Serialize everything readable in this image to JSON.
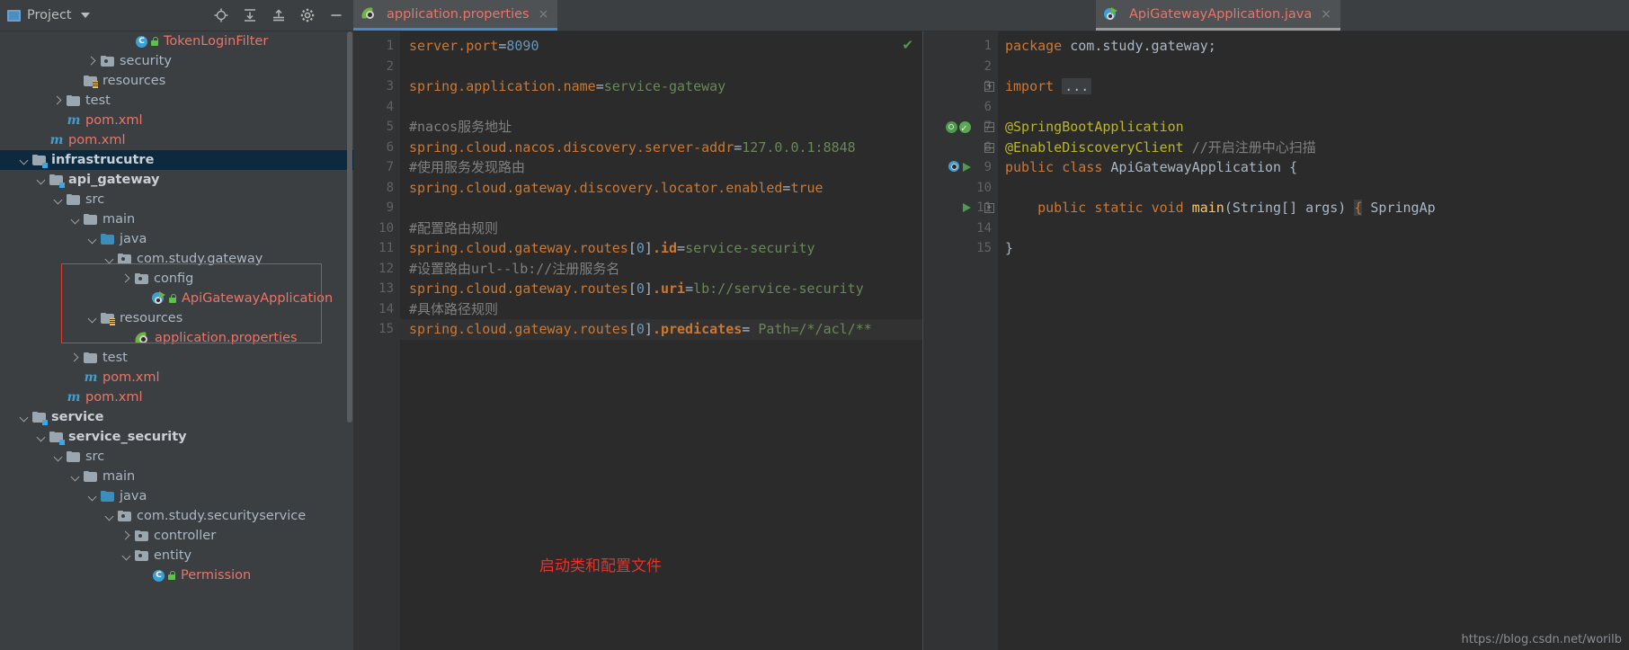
{
  "project_panel": {
    "title": "Project",
    "icons": [
      "locate-icon",
      "expand-all-icon",
      "collapse-all-icon",
      "settings-gear-icon",
      "minimize-icon"
    ],
    "tree": [
      {
        "label": "TokenLoginFilter",
        "type": "class",
        "indent": 7,
        "arrow": "none",
        "color": "red"
      },
      {
        "label": "security",
        "type": "package",
        "indent": 5,
        "arrow": "right",
        "color": "normal"
      },
      {
        "label": "resources",
        "type": "resources-folder",
        "indent": 4,
        "arrow": "none",
        "color": "normal"
      },
      {
        "label": "test",
        "type": "folder",
        "indent": 3,
        "arrow": "right",
        "color": "normal"
      },
      {
        "label": "pom.xml",
        "type": "maven",
        "indent": 3,
        "arrow": "none",
        "color": "red"
      },
      {
        "label": "pom.xml",
        "type": "maven",
        "indent": 2,
        "arrow": "none",
        "color": "red"
      },
      {
        "label": "infrastrucutre",
        "type": "module",
        "indent": 1,
        "arrow": "down",
        "color": "module",
        "selected": true
      },
      {
        "label": "api_gateway",
        "type": "module",
        "indent": 2,
        "arrow": "down",
        "color": "module"
      },
      {
        "label": "src",
        "type": "folder",
        "indent": 3,
        "arrow": "down",
        "color": "normal"
      },
      {
        "label": "main",
        "type": "folder",
        "indent": 4,
        "arrow": "down",
        "color": "normal"
      },
      {
        "label": "java",
        "type": "source-folder",
        "indent": 5,
        "arrow": "down",
        "color": "normal"
      },
      {
        "label": "com.study.gateway",
        "type": "package",
        "indent": 6,
        "arrow": "down",
        "color": "normal"
      },
      {
        "label": "config",
        "type": "package",
        "indent": 7,
        "arrow": "right",
        "color": "normal"
      },
      {
        "label": "ApiGatewayApplication",
        "type": "springboot-class",
        "indent": 8,
        "arrow": "none",
        "color": "red"
      },
      {
        "label": "resources",
        "type": "resources-folder",
        "indent": 5,
        "arrow": "down",
        "color": "normal"
      },
      {
        "label": "application.properties",
        "type": "spring-properties",
        "indent": 7,
        "arrow": "none",
        "color": "red"
      },
      {
        "label": "test",
        "type": "folder",
        "indent": 4,
        "arrow": "right",
        "color": "normal"
      },
      {
        "label": "pom.xml",
        "type": "maven",
        "indent": 4,
        "arrow": "none",
        "color": "red"
      },
      {
        "label": "pom.xml",
        "type": "maven",
        "indent": 3,
        "arrow": "none",
        "color": "red"
      },
      {
        "label": "service",
        "type": "module",
        "indent": 1,
        "arrow": "down",
        "color": "module"
      },
      {
        "label": "service_security",
        "type": "module",
        "indent": 2,
        "arrow": "down",
        "color": "module"
      },
      {
        "label": "src",
        "type": "folder",
        "indent": 3,
        "arrow": "down",
        "color": "normal"
      },
      {
        "label": "main",
        "type": "folder",
        "indent": 4,
        "arrow": "down",
        "color": "normal"
      },
      {
        "label": "java",
        "type": "source-folder",
        "indent": 5,
        "arrow": "down",
        "color": "normal"
      },
      {
        "label": "com.study.securityservice",
        "type": "package",
        "indent": 6,
        "arrow": "down",
        "color": "normal"
      },
      {
        "label": "controller",
        "type": "package",
        "indent": 7,
        "arrow": "right",
        "color": "normal"
      },
      {
        "label": "entity",
        "type": "package",
        "indent": 7,
        "arrow": "down",
        "color": "normal"
      },
      {
        "label": "Permission",
        "type": "class",
        "indent": 8,
        "arrow": "none",
        "color": "red"
      }
    ]
  },
  "editors": [
    {
      "tab": {
        "label": "application.properties",
        "icon": "spring-leaf-icon",
        "close": "×",
        "active": true
      },
      "status_icon": "check-icon",
      "lines": [
        {
          "n": "1",
          "tokens": [
            {
              "t": "server.port",
              "c": "key"
            },
            {
              "t": "=",
              "c": "plain"
            },
            {
              "t": "8090",
              "c": "num"
            }
          ]
        },
        {
          "n": "2",
          "tokens": []
        },
        {
          "n": "3",
          "tokens": [
            {
              "t": "spring.application.name",
              "c": "key"
            },
            {
              "t": "=",
              "c": "plain"
            },
            {
              "t": "service-gateway",
              "c": "val"
            }
          ]
        },
        {
          "n": "4",
          "tokens": []
        },
        {
          "n": "5",
          "tokens": [
            {
              "t": "#nacos服务地址",
              "c": "com"
            }
          ]
        },
        {
          "n": "6",
          "tokens": [
            {
              "t": "spring.cloud.nacos.discovery.server-addr",
              "c": "key"
            },
            {
              "t": "=",
              "c": "plain"
            },
            {
              "t": "127.0.0.1:8848",
              "c": "val"
            }
          ]
        },
        {
          "n": "7",
          "tokens": [
            {
              "t": "#使用服务发现路由",
              "c": "com"
            }
          ]
        },
        {
          "n": "8",
          "tokens": [
            {
              "t": "spring.cloud.gateway.discovery.locator.enabled",
              "c": "key"
            },
            {
              "t": "=",
              "c": "plain"
            },
            {
              "t": "true",
              "c": "key"
            }
          ]
        },
        {
          "n": "9",
          "tokens": []
        },
        {
          "n": "10",
          "tokens": [
            {
              "t": "#配置路由规则",
              "c": "com"
            }
          ]
        },
        {
          "n": "11",
          "tokens": [
            {
              "t": "spring.cloud.gateway.routes",
              "c": "key"
            },
            {
              "t": "[",
              "c": "plain"
            },
            {
              "t": "0",
              "c": "num"
            },
            {
              "t": "]",
              "c": "plain"
            },
            {
              "t": ".id",
              "c": "bold"
            },
            {
              "t": "=",
              "c": "plain"
            },
            {
              "t": "service-security",
              "c": "val"
            }
          ]
        },
        {
          "n": "12",
          "tokens": [
            {
              "t": "#设置路由url--lb://注册服务名",
              "c": "com"
            }
          ]
        },
        {
          "n": "13",
          "tokens": [
            {
              "t": "spring.cloud.gateway.routes",
              "c": "key"
            },
            {
              "t": "[",
              "c": "plain"
            },
            {
              "t": "0",
              "c": "num"
            },
            {
              "t": "]",
              "c": "plain"
            },
            {
              "t": ".uri",
              "c": "bold"
            },
            {
              "t": "=",
              "c": "plain"
            },
            {
              "t": "lb://service-security",
              "c": "val"
            }
          ]
        },
        {
          "n": "14",
          "tokens": [
            {
              "t": "#具体路径规则",
              "c": "com"
            }
          ]
        },
        {
          "n": "15",
          "highlight": true,
          "tokens": [
            {
              "t": "spring.cloud.gateway.routes",
              "c": "key"
            },
            {
              "t": "[",
              "c": "plain"
            },
            {
              "t": "0",
              "c": "num"
            },
            {
              "t": "]",
              "c": "plain"
            },
            {
              "t": ".predicates",
              "c": "bold"
            },
            {
              "t": "=",
              "c": "plain"
            },
            {
              "t": " Path=/*/acl/**",
              "c": "val"
            }
          ]
        }
      ],
      "annotation": "启动类和配置文件"
    },
    {
      "tab": {
        "label": "ApiGatewayApplication.java",
        "icon": "springboot-class-icon",
        "close": "×",
        "active": true
      },
      "lines": [
        {
          "n": "1",
          "tokens": [
            {
              "t": "package",
              "c": "key"
            },
            {
              "t": " com.study.gateway;",
              "c": "plain"
            }
          ]
        },
        {
          "n": "2",
          "tokens": []
        },
        {
          "n": "3",
          "fold": "plus",
          "tokens": [
            {
              "t": "import",
              "c": "key"
            },
            {
              "t": " ",
              "c": "plain"
            },
            {
              "t": "...",
              "c": "importbox"
            }
          ]
        },
        {
          "n": "6",
          "tokens": []
        },
        {
          "n": "7",
          "gutter_icons": [
            "bean-icon",
            "bean-check-icon"
          ],
          "fold": "minus",
          "tokens": [
            {
              "t": "@SpringBootApplication",
              "c": "anno"
            }
          ]
        },
        {
          "n": "8",
          "fold": "minus",
          "tokens": [
            {
              "t": "@EnableDiscoveryClient",
              "c": "anno"
            },
            {
              "t": " //开启注册中心扫描",
              "c": "com"
            }
          ]
        },
        {
          "n": "9",
          "gutter_icons": [
            "springboot-mini-icon",
            "run-icon"
          ],
          "tokens": [
            {
              "t": "public",
              "c": "key"
            },
            {
              "t": " ",
              "c": "plain"
            },
            {
              "t": "class",
              "c": "key"
            },
            {
              "t": " ",
              "c": "plain"
            },
            {
              "t": "ApiGatewayApplication",
              "c": "cls"
            },
            {
              "t": " {",
              "c": "plain"
            }
          ]
        },
        {
          "n": "10",
          "tokens": []
        },
        {
          "n": "11",
          "gutter_icons": [
            "run-icon"
          ],
          "fold": "plus",
          "tokens": [
            {
              "t": "    ",
              "c": "plain"
            },
            {
              "t": "public",
              "c": "key"
            },
            {
              "t": " ",
              "c": "plain"
            },
            {
              "t": "static",
              "c": "key"
            },
            {
              "t": " ",
              "c": "plain"
            },
            {
              "t": "void",
              "c": "key"
            },
            {
              "t": " ",
              "c": "plain"
            },
            {
              "t": "main",
              "c": "mth"
            },
            {
              "t": "(String[] args) ",
              "c": "plain"
            },
            {
              "t": "{",
              "c": "bracehl"
            },
            {
              "t": " SpringAp",
              "c": "plain"
            }
          ]
        },
        {
          "n": "14",
          "tokens": []
        },
        {
          "n": "15",
          "tokens": [
            {
              "t": "}",
              "c": "plain"
            }
          ]
        }
      ]
    }
  ],
  "watermark": "https://blog.csdn.net/worilb",
  "colors": {
    "panel_bg": "#3c3f41",
    "editor_bg": "#2b2b2b",
    "gutter_bg": "#313335",
    "selection": "#0d293e",
    "accent_red": "#e03c31",
    "file_red": "#e8756a",
    "annotation_red": "#e8312a",
    "tab_active_underline": "#4a88c7"
  }
}
